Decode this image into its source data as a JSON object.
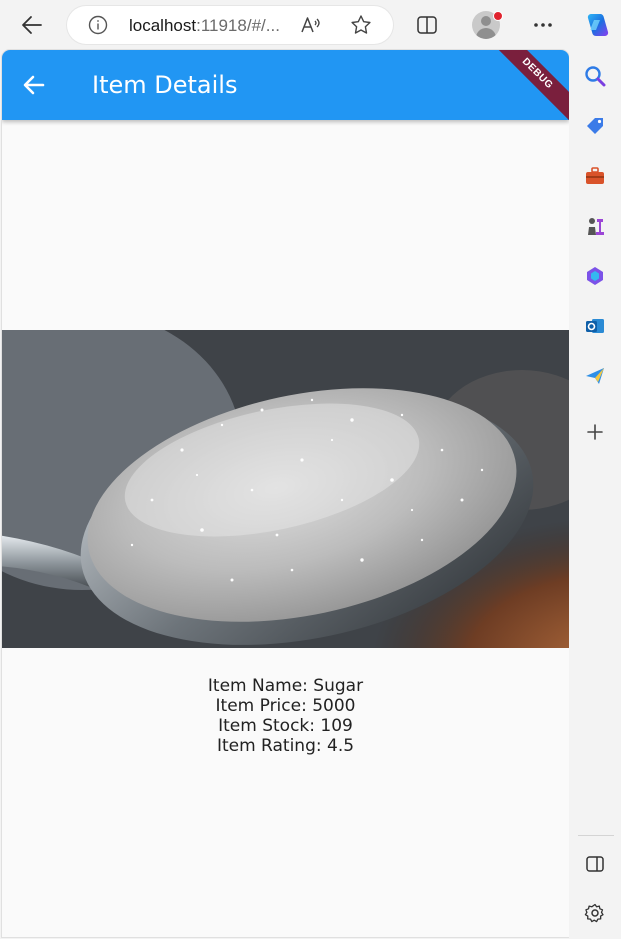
{
  "browser": {
    "address": {
      "host": "localhost",
      "rest": ":11918/#/..."
    },
    "icons": {
      "back": "arrow-left-icon",
      "info": "info-icon",
      "read_aloud": "read-aloud-icon",
      "favorite": "star-icon",
      "split_screen": "split-screen-icon",
      "profile": "avatar",
      "more": "more-icon",
      "copilot": "copilot-icon"
    }
  },
  "appbar": {
    "title": "Item Details",
    "color": "#2196f3",
    "debug_label": "DEBUG"
  },
  "item": {
    "name_line": "Item Name: Sugar",
    "price_line": "Item Price: 5000",
    "stock_line": "Item Stock: 109",
    "rating_line": "Item Rating: 4.5"
  },
  "sidebar": {
    "icons": [
      "search-icon",
      "tag-icon",
      "toolbox-icon",
      "chess-icon",
      "m365-icon",
      "outlook-icon",
      "send-icon",
      "add-icon",
      "sidebar-toggle-icon",
      "settings-icon"
    ]
  }
}
